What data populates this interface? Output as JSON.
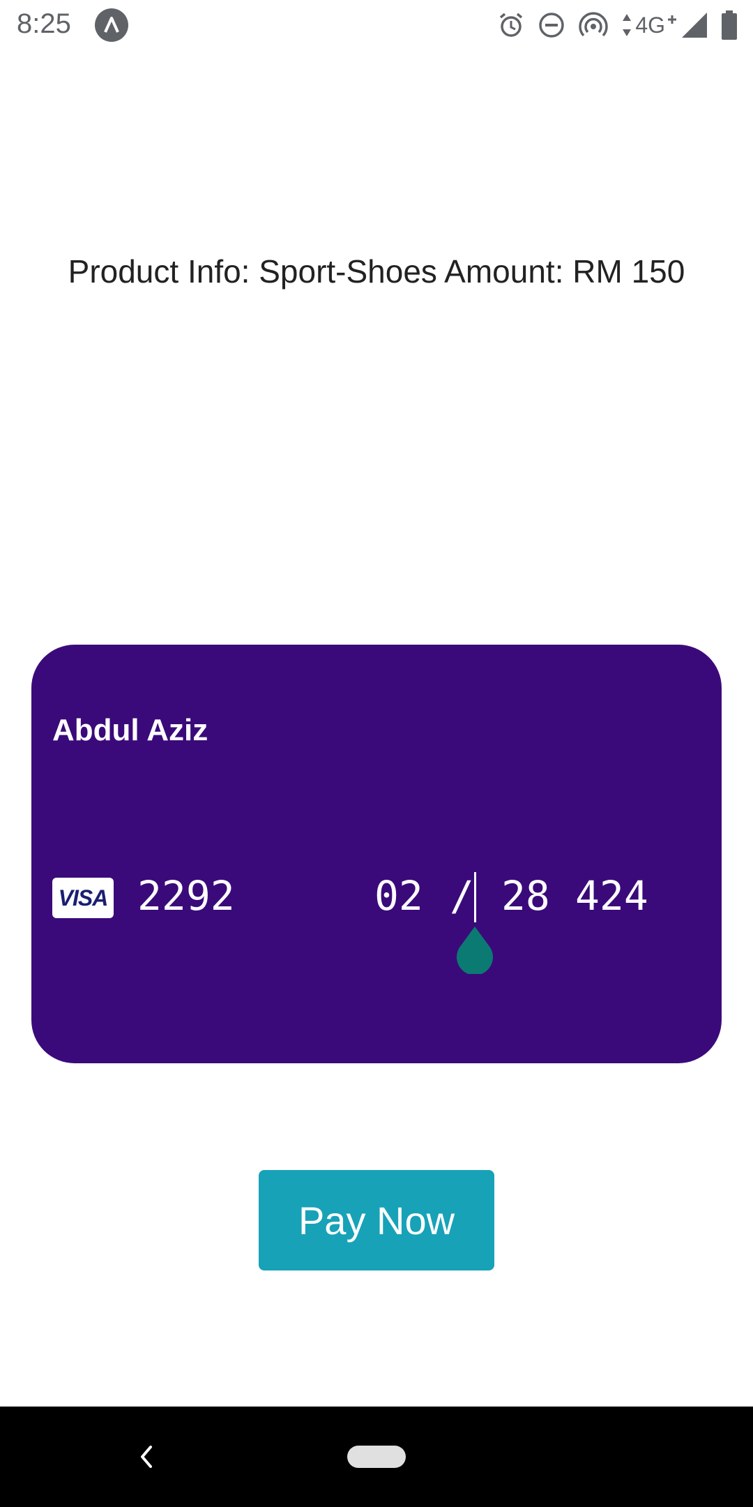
{
  "status_bar": {
    "time": "8:25",
    "network_label": "4G",
    "icons": [
      "app-notification-icon",
      "alarm-icon",
      "do-not-disturb-icon",
      "hotspot-icon",
      "data-arrows-icon",
      "signal-icon",
      "battery-icon"
    ]
  },
  "product": {
    "info_text": "Product Info: Sport-Shoes Amount: RM 150"
  },
  "card": {
    "holder_name": "Abdul Aziz",
    "brand": "VISA",
    "number": "2292",
    "exp_month": "02",
    "exp_separator": "/",
    "exp_year": "28",
    "cvc": "424",
    "background_color": "#3b0a7a"
  },
  "actions": {
    "pay_label": "Pay Now",
    "button_color": "#17a2b8"
  },
  "navigation": {
    "icons": [
      "back-icon",
      "home-pill-icon"
    ]
  }
}
